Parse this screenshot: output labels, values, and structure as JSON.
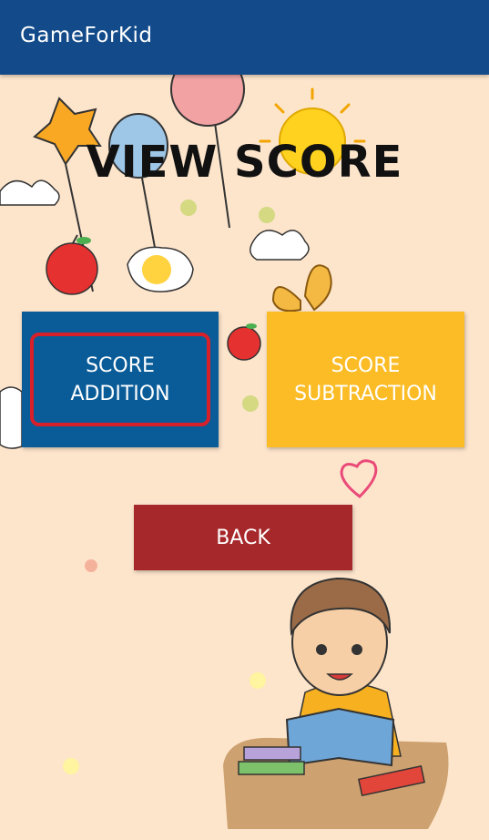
{
  "app_bar": {
    "title": "GameForKid"
  },
  "page": {
    "title": "VIEW SCORE"
  },
  "buttons": {
    "score_addition": {
      "line1": "SCORE",
      "line2": "ADDITION",
      "color": "#0a5c98",
      "highlight": "#d8202a"
    },
    "score_subtraction": {
      "line1": "SCORE",
      "line2": "SUBTRACTION",
      "color": "#fbbc25"
    },
    "back": {
      "label": "BACK",
      "color": "#a6282b"
    }
  },
  "theme": {
    "header": "#134b8a",
    "background": "#fde5cc"
  }
}
